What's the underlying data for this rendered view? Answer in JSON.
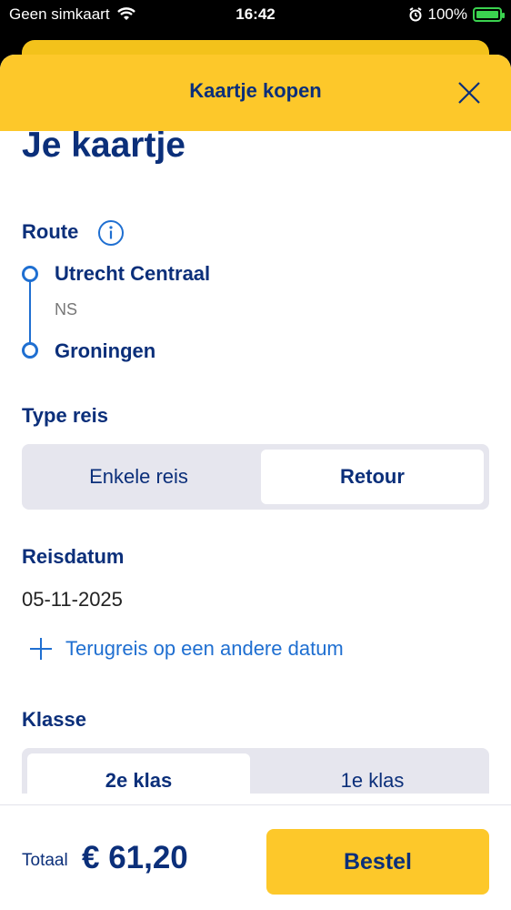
{
  "status_bar": {
    "carrier": "Geen simkaart",
    "time": "16:42",
    "battery": "100%"
  },
  "header": {
    "title": "Kaartje kopen"
  },
  "page": {
    "title": "Je kaartje"
  },
  "route": {
    "label": "Route",
    "from": "Utrecht Centraal",
    "operator": "NS",
    "to": "Groningen"
  },
  "trip_type": {
    "label": "Type reis",
    "options": [
      "Enkele reis",
      "Retour"
    ],
    "selected": "Retour"
  },
  "date": {
    "label": "Reisdatum",
    "value": "05-11-2025",
    "return_link": "Terugreis op een andere datum"
  },
  "class": {
    "label": "Klasse",
    "options": [
      "2e klas",
      "1e klas"
    ],
    "selected": "2e klas"
  },
  "footer": {
    "total_label": "Totaal",
    "total_amount": "€ 61,20",
    "order_button": "Bestel"
  },
  "colors": {
    "brand_yellow": "#fdc82a",
    "brand_blue": "#0b2f7a",
    "link_blue": "#1f6fd1",
    "battery_green": "#3bd24f"
  }
}
